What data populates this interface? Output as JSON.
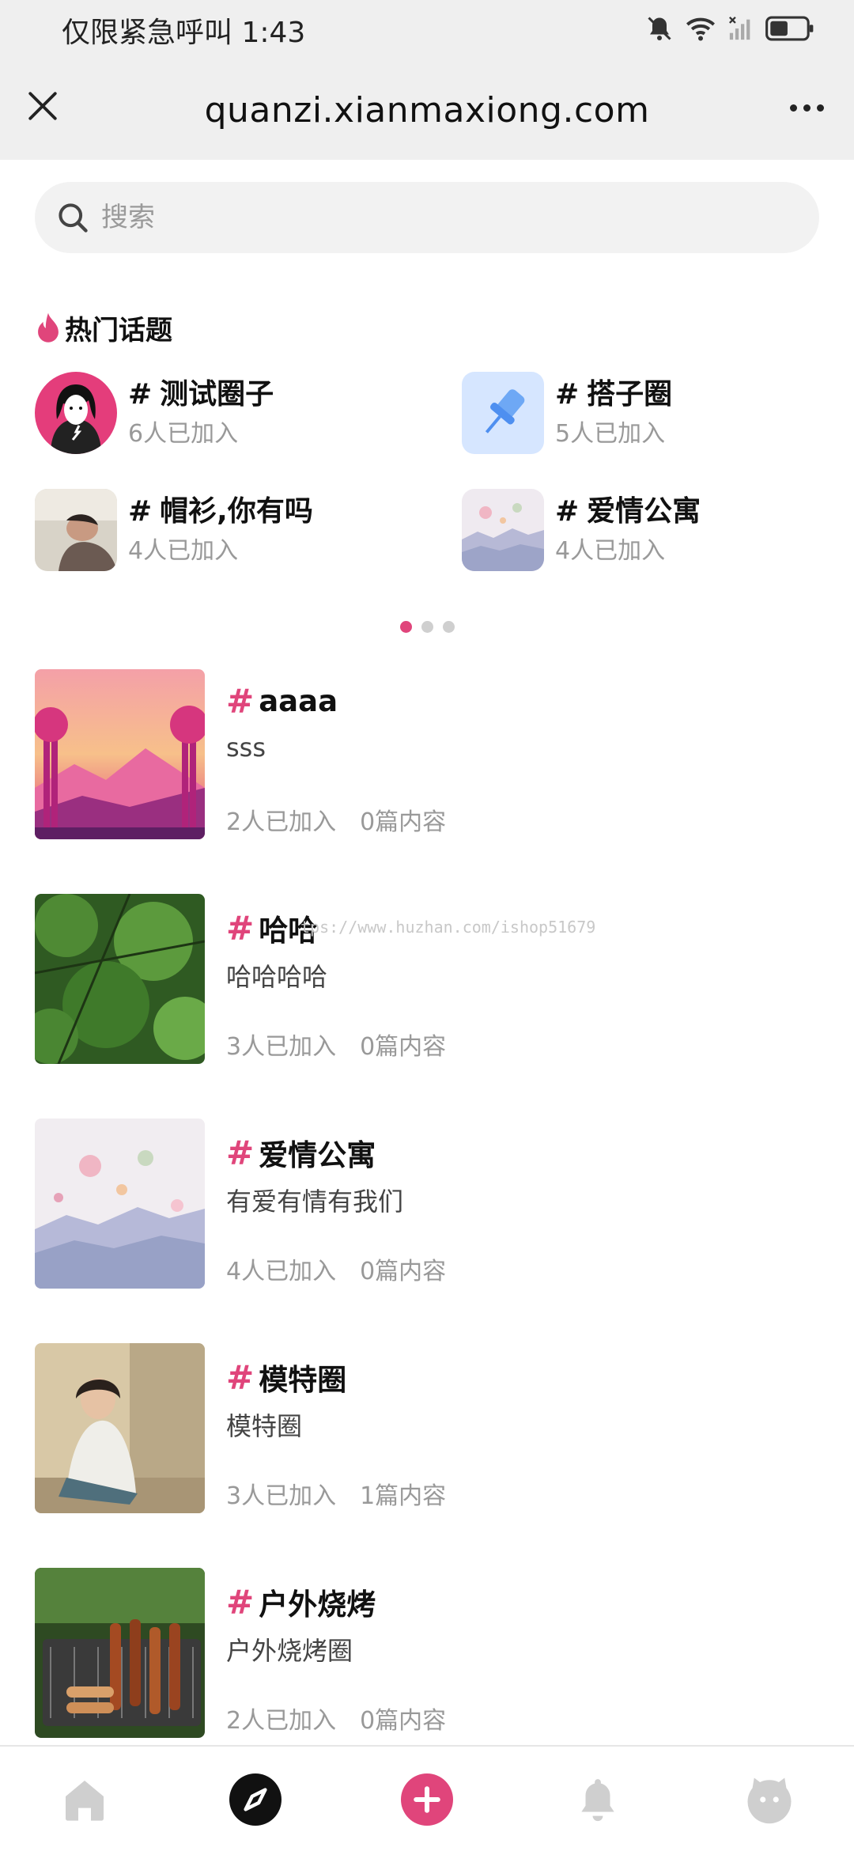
{
  "status_bar": {
    "text": "仅限紧急呼叫 1:43"
  },
  "browser": {
    "url": "quanzi.xianmaxiong.com"
  },
  "search": {
    "placeholder": "搜索"
  },
  "hot_topics": {
    "title": "热门话题",
    "items": [
      {
        "hash": "#",
        "name": "测试圈子",
        "count": "6人已加入"
      },
      {
        "hash": "#",
        "name": "搭子圈",
        "count": "5人已加入"
      },
      {
        "hash": "#",
        "name": "帽衫,你有吗",
        "count": "4人已加入"
      },
      {
        "hash": "#",
        "name": "爱情公寓",
        "count": "4人已加入"
      }
    ],
    "pager": {
      "pages": 3,
      "active": 1
    }
  },
  "circles": [
    {
      "hash": "#",
      "name": "aaaa",
      "desc": "sss",
      "members": "2人已加入",
      "posts": "0篇内容"
    },
    {
      "hash": "#",
      "name": "哈哈",
      "desc": "哈哈哈哈",
      "members": "3人已加入",
      "posts": "0篇内容"
    },
    {
      "hash": "#",
      "name": "爱情公寓",
      "desc": "有爱有情有我们",
      "members": "4人已加入",
      "posts": "0篇内容"
    },
    {
      "hash": "#",
      "name": "模特圈",
      "desc": "模特圈",
      "members": "3人已加入",
      "posts": "1篇内容"
    },
    {
      "hash": "#",
      "name": "户外烧烤",
      "desc": "户外烧烤圈",
      "members": "2人已加入",
      "posts": "0篇内容"
    }
  ],
  "watermark": "tps://www.huzhan.com/ishop51679",
  "bottom_nav": [
    "home-icon",
    "compass-icon",
    "add-icon",
    "bell-icon",
    "profile-icon"
  ],
  "colors": {
    "accent": "#e0457b",
    "header_bg": "#efefef"
  }
}
